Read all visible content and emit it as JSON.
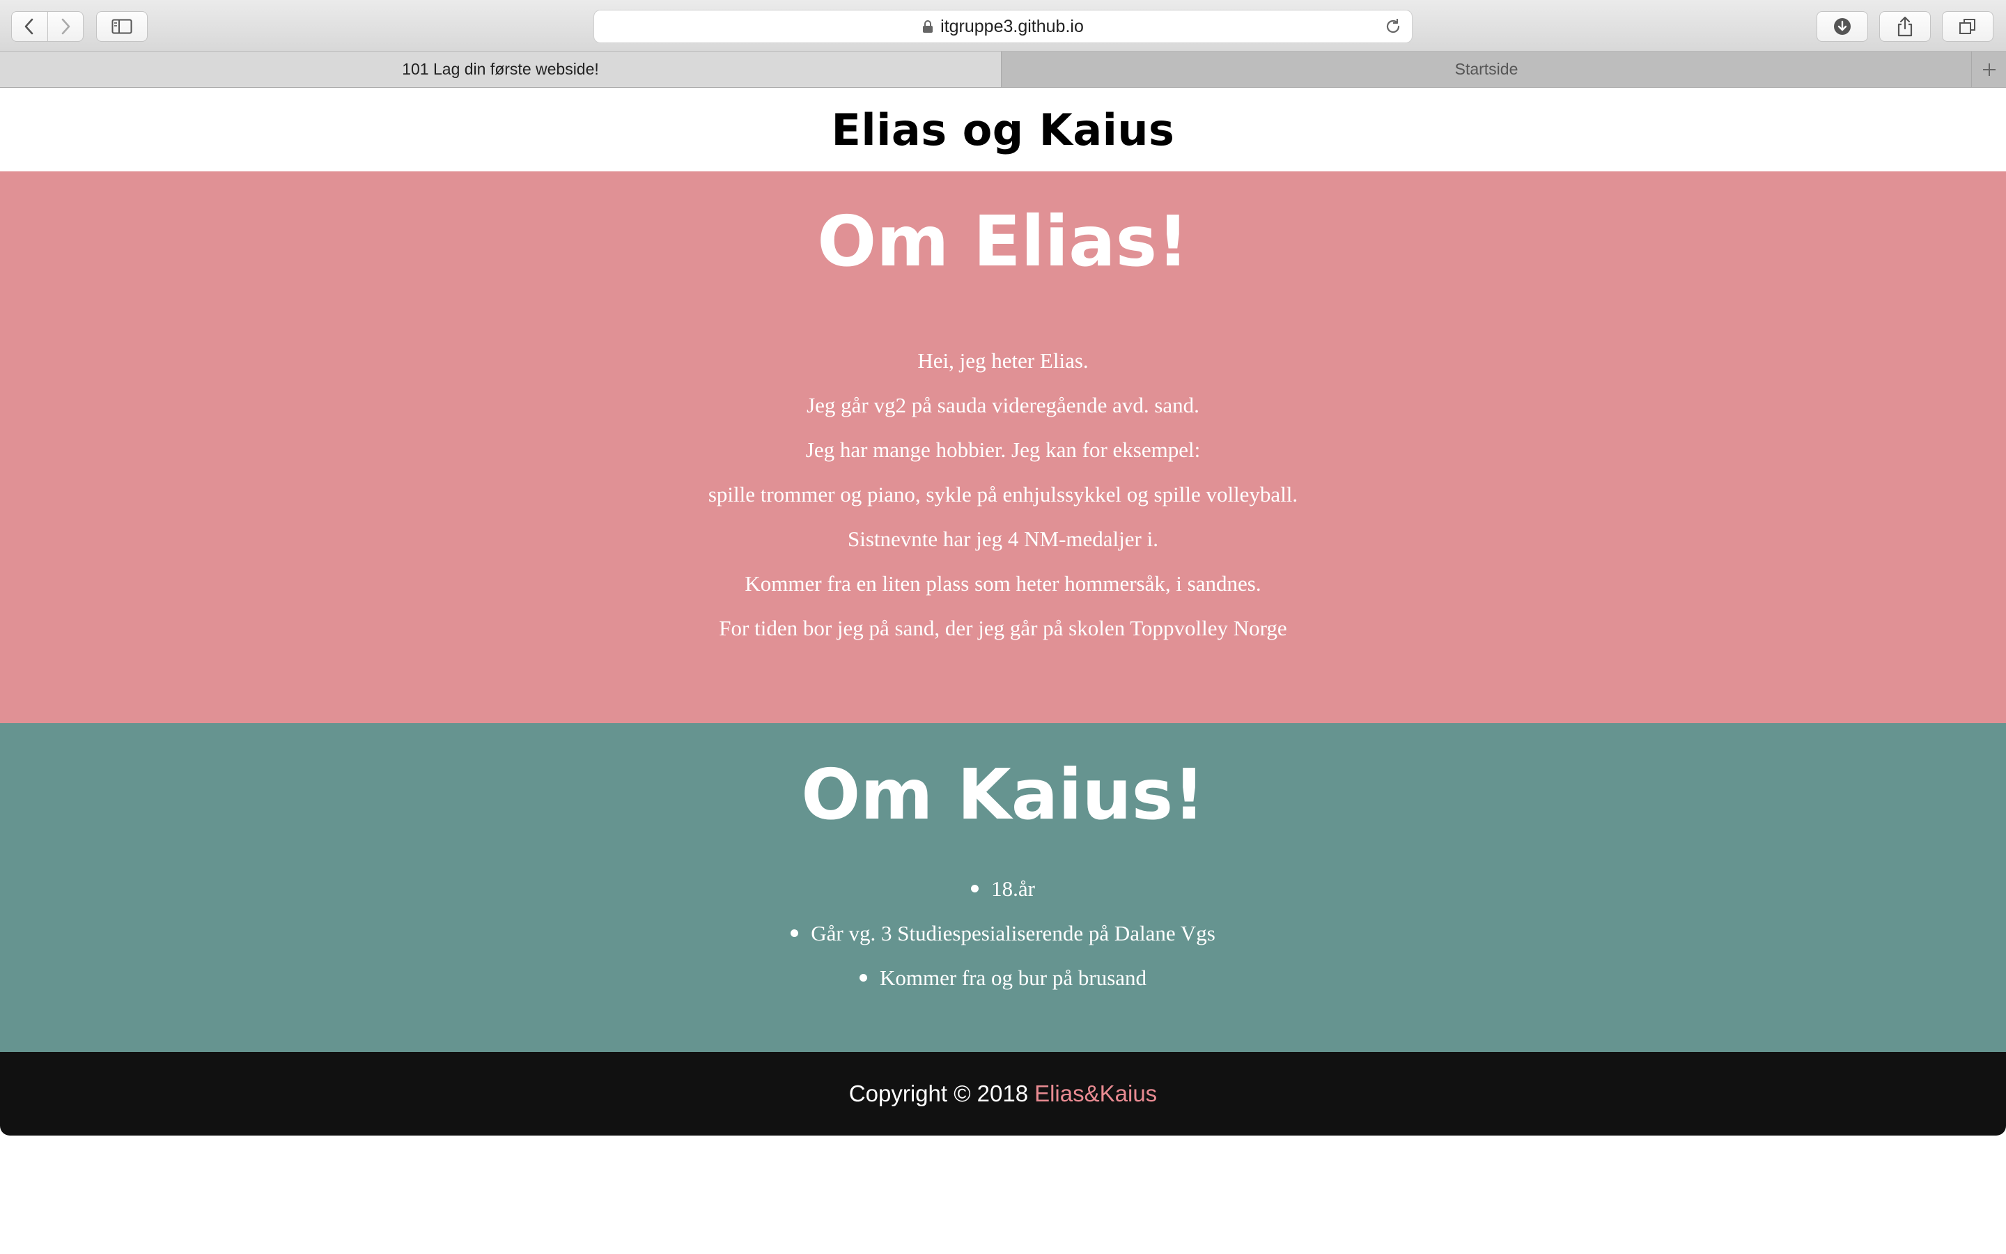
{
  "browser": {
    "url": "itgruppe3.github.io",
    "tabs": [
      {
        "label": "101 Lag din første webside!",
        "active": true
      },
      {
        "label": "Startside",
        "active": false
      }
    ],
    "icons": [
      "back-icon",
      "forward-icon",
      "sidebar-icon",
      "lock-icon",
      "reload-icon",
      "download-icon",
      "share-icon",
      "tabs-overview-icon",
      "new-tab-icon"
    ]
  },
  "header": {
    "title": "Elias og Kaius"
  },
  "elias": {
    "heading": "Om Elias!",
    "paragraphs": [
      "Hei, jeg heter Elias.",
      "Jeg går vg2 på sauda videregående avd. sand.",
      "Jeg har mange hobbier. Jeg kan for eksempel:",
      "spille trommer og piano, sykle på enhjulssykkel og spille volleyball.",
      "Sistnevnte har jeg 4 NM-medaljer i.",
      "Kommer fra en liten plass som heter hommersåk, i sandnes.",
      "For tiden bor jeg på sand, der jeg går på skolen Toppvolley Norge"
    ],
    "bg_color": "#e09195"
  },
  "kaius": {
    "heading": "Om Kaius!",
    "items": [
      "18.år",
      "Går vg. 3 Studiespesialiserende på Dalane Vgs",
      "Kommer fra og bur på brusand"
    ],
    "bg_color": "#669490"
  },
  "footer": {
    "text": "Copyright © 2018",
    "link": "Elias&Kaius",
    "link_color": "#e98b92",
    "bg_color": "#111111"
  }
}
